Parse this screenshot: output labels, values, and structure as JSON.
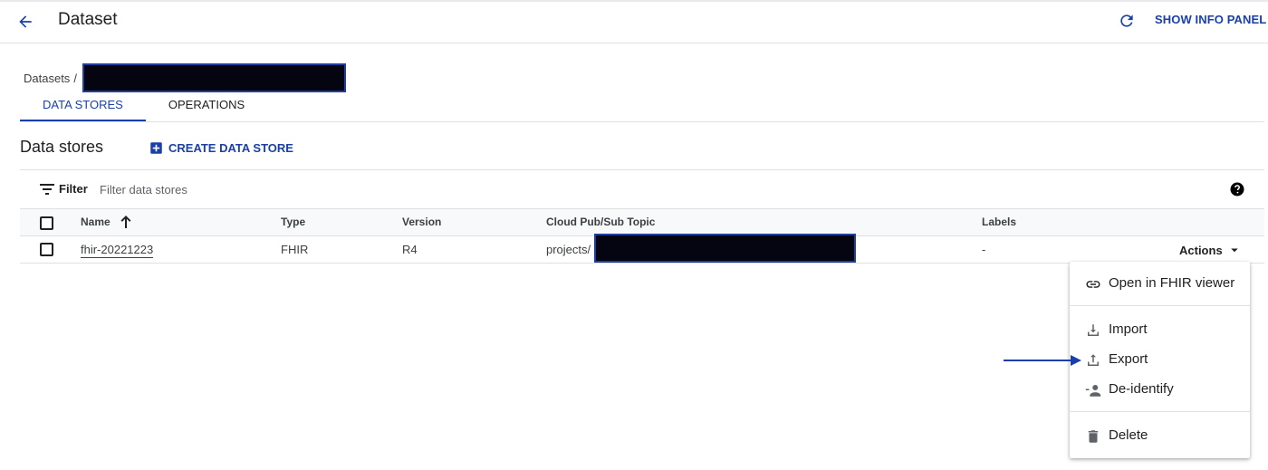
{
  "header": {
    "title": "Dataset",
    "info_panel_label": "SHOW INFO PANEL"
  },
  "breadcrumb": {
    "root": "Datasets",
    "separator": "/"
  },
  "tabs": [
    {
      "label": "DATA STORES",
      "active": true
    },
    {
      "label": "OPERATIONS",
      "active": false
    }
  ],
  "section": {
    "title": "Data stores",
    "create_label": "CREATE DATA STORE"
  },
  "filter": {
    "label": "Filter",
    "placeholder": "Filter data stores"
  },
  "table": {
    "columns": [
      "Name",
      "Type",
      "Version",
      "Cloud Pub/Sub Topic",
      "Labels"
    ],
    "rows": [
      {
        "name": "fhir-20221223",
        "type": "FHIR",
        "version": "R4",
        "topic_prefix": "projects/",
        "labels": "-",
        "actions_label": "Actions"
      }
    ]
  },
  "menu": {
    "items": [
      {
        "label": "Open in FHIR viewer",
        "icon": "link-icon"
      },
      {
        "label": "Import",
        "icon": "download-icon"
      },
      {
        "label": "Export",
        "icon": "upload-icon"
      },
      {
        "label": "De-identify",
        "icon": "person-remove-icon"
      },
      {
        "label": "Delete",
        "icon": "trash-icon"
      }
    ]
  },
  "colors": {
    "accent": "#1a3fa8",
    "redaction": "#050512"
  }
}
